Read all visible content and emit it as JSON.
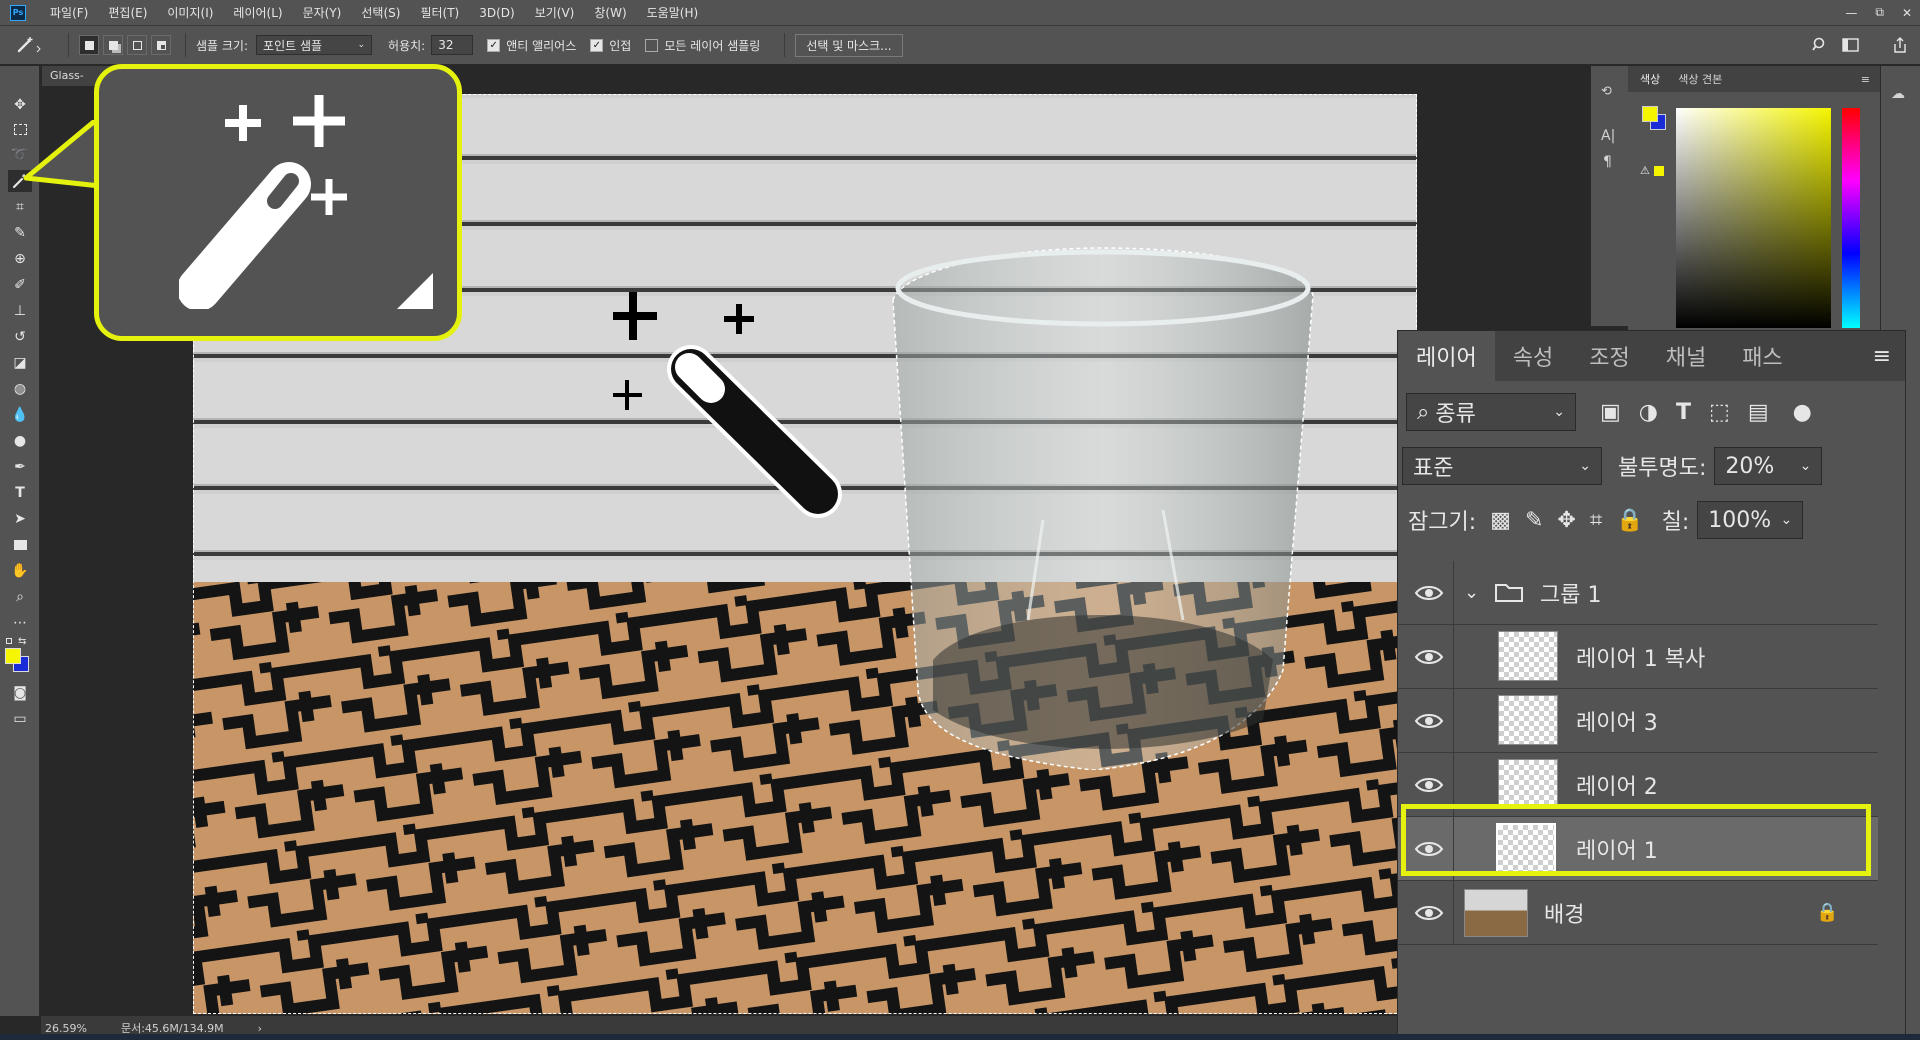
{
  "menubar": {
    "logo": "Ps",
    "items": [
      "파일(F)",
      "편집(E)",
      "이미지(I)",
      "레이어(L)",
      "문자(Y)",
      "선택(S)",
      "필터(T)",
      "3D(D)",
      "보기(V)",
      "창(W)",
      "도움말(H)"
    ],
    "window_controls": [
      "—",
      "⧉",
      "✕"
    ]
  },
  "options": {
    "sample_size_label": "샘플 크기:",
    "sample_size_value": "포인트 샘플",
    "tolerance_label": "허용치:",
    "tolerance_value": "32",
    "antialias_label": "앤티 앨리어스",
    "antialias_checked": true,
    "contiguous_label": "인접",
    "contiguous_checked": true,
    "sample_all_label": "모든 레이어 샘플링",
    "sample_all_checked": false,
    "select_mask_button": "선택 및 마스크..."
  },
  "document": {
    "tab_title": "Glass-"
  },
  "statusbar": {
    "zoom": "26.59%",
    "doc_size": "문서:45.6M/134.9M",
    "arrow": "›"
  },
  "color_panel": {
    "tabs": [
      "색상",
      "색상 견본"
    ],
    "foreground_color": "#f5f500",
    "background_color": "#1a2bd8"
  },
  "layers_panel": {
    "tabs": [
      "레이어",
      "속성",
      "조정",
      "채널",
      "패스"
    ],
    "filter_label": "종류",
    "blend_mode": "표준",
    "opacity_label": "불투명도:",
    "opacity_value": "20%",
    "lock_label": "잠그기:",
    "fill_label": "칠:",
    "fill_value": "100%",
    "layers": [
      {
        "name": "그룹 1",
        "type": "group"
      },
      {
        "name": "레이어 1 복사",
        "type": "layer"
      },
      {
        "name": "레이어 3",
        "type": "layer"
      },
      {
        "name": "레이어 2",
        "type": "layer"
      },
      {
        "name": "레이어 1",
        "type": "layer",
        "selected": true
      },
      {
        "name": "배경",
        "type": "background",
        "locked": true
      }
    ]
  },
  "accent": {
    "highlight": "#e5f20e"
  }
}
